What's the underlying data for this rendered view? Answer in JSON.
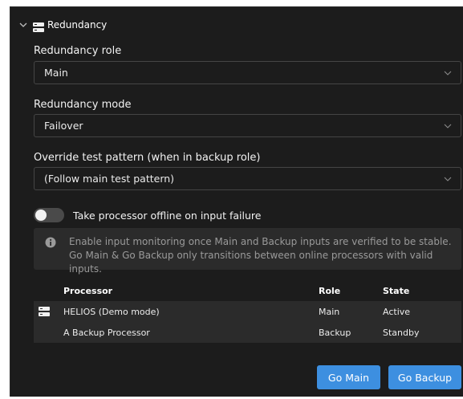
{
  "section": {
    "title": "Redundancy",
    "icon": "server-icon",
    "expanded_icon": "chevron-down-icon"
  },
  "fields": {
    "role": {
      "label": "Redundancy role",
      "value": "Main"
    },
    "mode": {
      "label": "Redundancy mode",
      "value": "Failover"
    },
    "override": {
      "label": "Override test pattern (when in backup role)",
      "value": "(Follow main test pattern)"
    }
  },
  "toggle": {
    "label": "Take processor offline on input failure",
    "state": "off"
  },
  "info": {
    "line1": "Enable input monitoring once Main and Backup inputs are verified to be stable.",
    "line2": "Go Main & Go Backup only transitions between online processors with valid inputs."
  },
  "table": {
    "headers": [
      "Processor",
      "Role",
      "State"
    ],
    "rows": [
      {
        "icon": "server-icon",
        "processor": "HELIOS (Demo mode)",
        "role": "Main",
        "state": "Active"
      },
      {
        "icon": "",
        "processor": "A Backup Processor",
        "role": "Backup",
        "state": "Standby"
      }
    ]
  },
  "buttons": {
    "go_main": "Go Main",
    "go_backup": "Go Backup"
  },
  "colors": {
    "panel_bg": "#1c1c1c",
    "accent": "#3d8fe0",
    "info_bg": "#2b2b2b"
  }
}
